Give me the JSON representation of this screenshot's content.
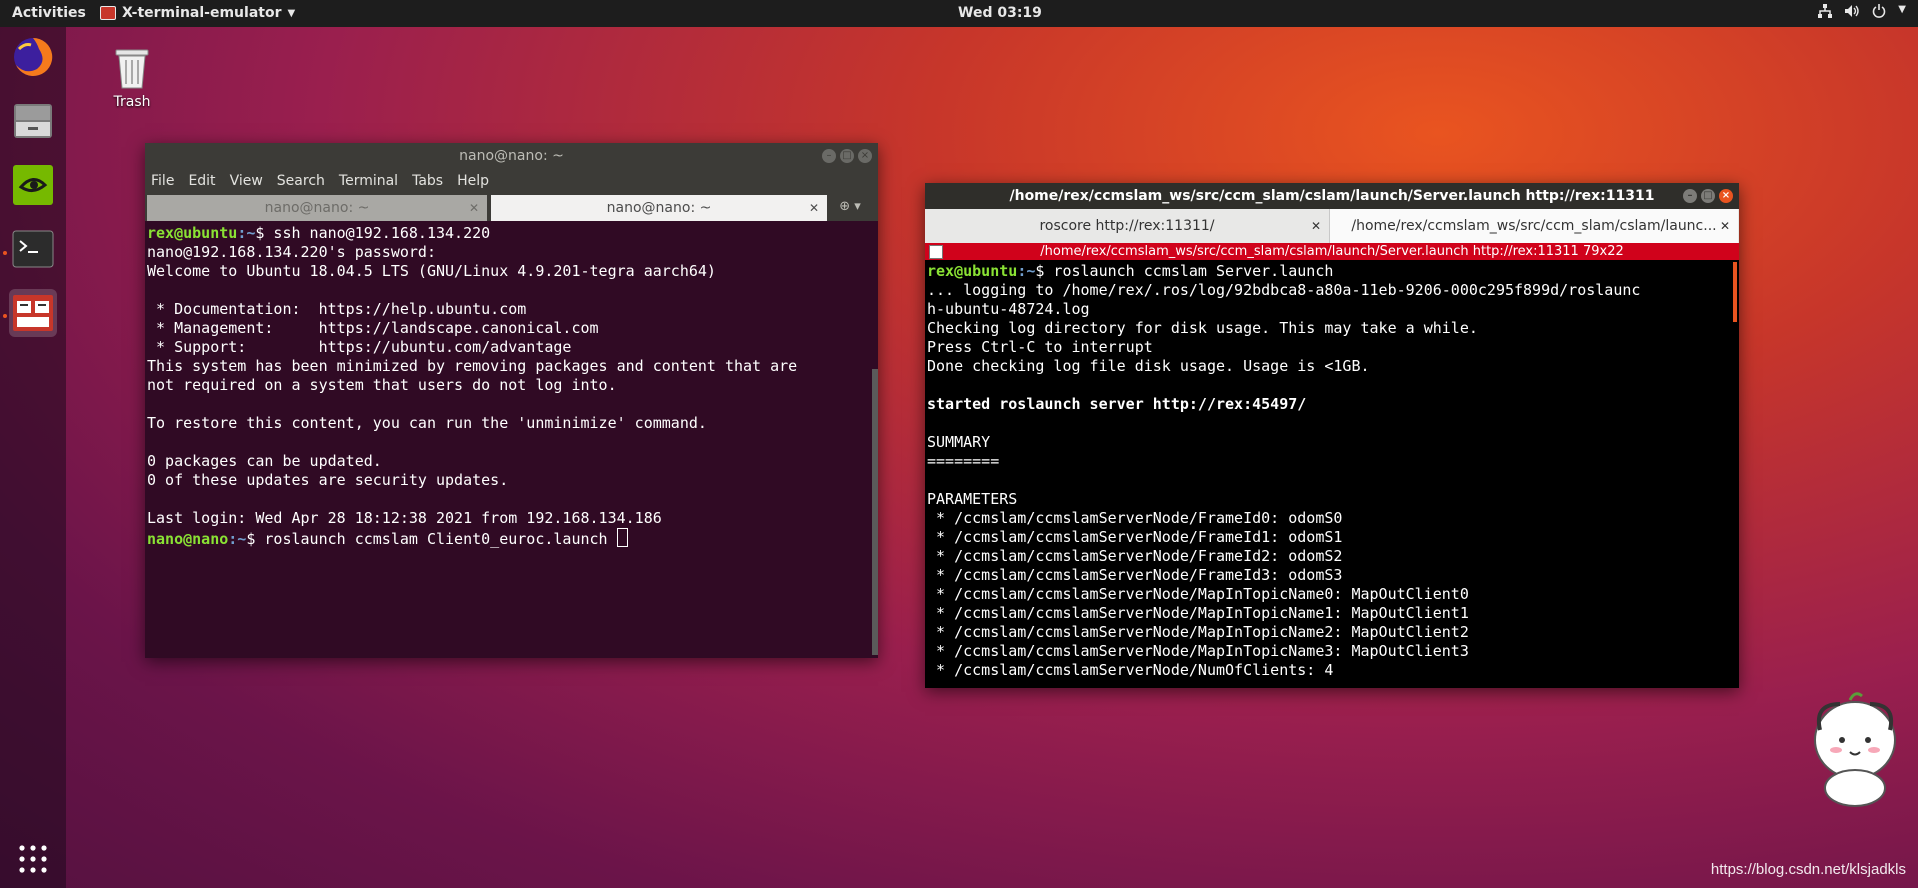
{
  "topbar": {
    "activities": "Activities",
    "app_name": "X-terminal-emulator",
    "clock": "Wed 03:19"
  },
  "desktop": {
    "trash_label": "Trash",
    "watermark": "https://blog.csdn.net/klsjadkls"
  },
  "dock": {
    "items": [
      "firefox-icon",
      "files-icon",
      "nvidia-icon",
      "terminal-icon",
      "app-icon"
    ]
  },
  "win1": {
    "title": "nano@nano: ~",
    "menu": [
      "File",
      "Edit",
      "View",
      "Search",
      "Terminal",
      "Tabs",
      "Help"
    ],
    "tabs": [
      "nano@nano: ~",
      "nano@nano: ~"
    ],
    "lines": {
      "l1_user": "rex@ubuntu",
      "l1_path": ":~",
      "l1_cmd": "$ ssh nano@192.168.134.220",
      "l2": "nano@192.168.134.220's password:",
      "l3": "Welcome to Ubuntu 18.04.5 LTS (GNU/Linux 4.9.201-tegra aarch64)",
      "l4": "",
      "l5": " * Documentation:  https://help.ubuntu.com",
      "l6": " * Management:     https://landscape.canonical.com",
      "l7": " * Support:        https://ubuntu.com/advantage",
      "l8": "This system has been minimized by removing packages and content that are",
      "l9": "not required on a system that users do not log into.",
      "l10": "",
      "l11": "To restore this content, you can run the 'unminimize' command.",
      "l12": "",
      "l13": "0 packages can be updated.",
      "l14": "0 of these updates are security updates.",
      "l15": "",
      "l16": "Last login: Wed Apr 28 18:12:38 2021 from 192.168.134.186",
      "l17_user": "nano@nano",
      "l17_path": ":~",
      "l17_cmd": "$ roslaunch ccmslam Client0_euroc.launch "
    }
  },
  "win2": {
    "title": "/home/rex/ccmslam_ws/src/ccm_slam/cslam/launch/Server.launch http://rex:11311",
    "tabs": [
      "roscore http://rex:11311/",
      "/home/rex/ccmslam_ws/src/ccm_slam/cslam/launc..."
    ],
    "redbar": "/home/rex/ccmslam_ws/src/ccm_slam/cslam/launch/Server.launch http://rex:11311 79x22",
    "lines": {
      "l1_user": "rex@ubuntu",
      "l1_path": ":~",
      "l1_cmd": "$ roslaunch ccmslam Server.launch",
      "l2": "... logging to /home/rex/.ros/log/92bdbca8-a80a-11eb-9206-000c295f899d/roslaunc",
      "l3": "h-ubuntu-48724.log",
      "l4": "Checking log directory for disk usage. This may take a while.",
      "l5": "Press Ctrl-C to interrupt",
      "l6": "Done checking log file disk usage. Usage is <1GB.",
      "l7": "",
      "l8": "started roslaunch server http://rex:45497/",
      "l9": "",
      "l10": "SUMMARY",
      "l11": "========",
      "l12": "",
      "l13": "PARAMETERS",
      "l14": " * /ccmslam/ccmslamServerNode/FrameId0: odomS0",
      "l15": " * /ccmslam/ccmslamServerNode/FrameId1: odomS1",
      "l16": " * /ccmslam/ccmslamServerNode/FrameId2: odomS2",
      "l17": " * /ccmslam/ccmslamServerNode/FrameId3: odomS3",
      "l18": " * /ccmslam/ccmslamServerNode/MapInTopicName0: MapOutClient0",
      "l19": " * /ccmslam/ccmslamServerNode/MapInTopicName1: MapOutClient1",
      "l20": " * /ccmslam/ccmslamServerNode/MapInTopicName2: MapOutClient2",
      "l21": " * /ccmslam/ccmslamServerNode/MapInTopicName3: MapOutClient3",
      "l22": " * /ccmslam/ccmslamServerNode/NumOfClients: 4"
    }
  }
}
